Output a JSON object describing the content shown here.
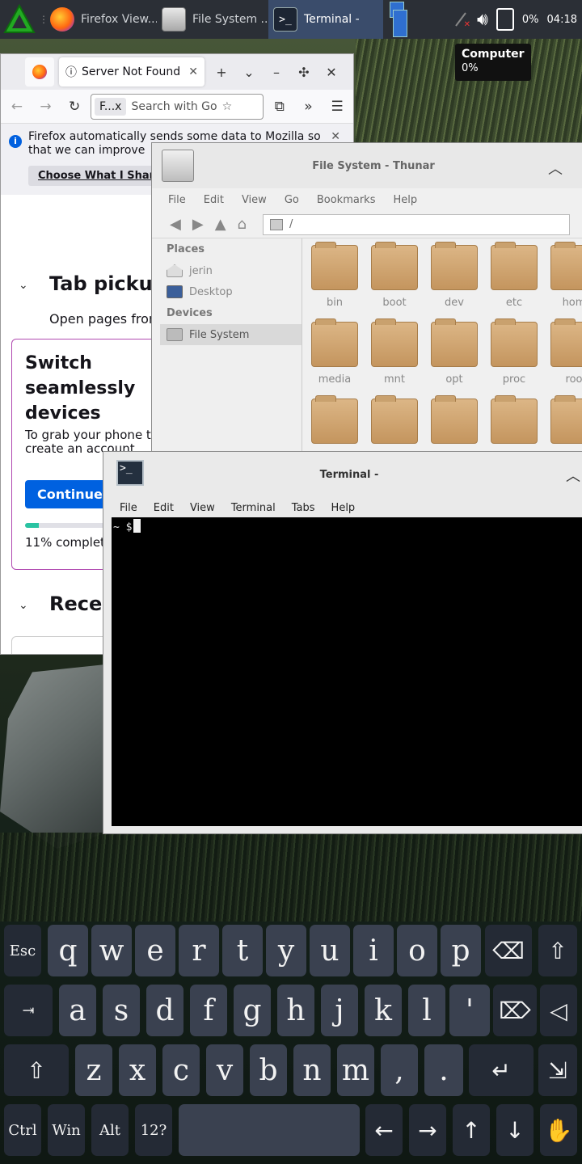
{
  "panel": {
    "tasks": [
      {
        "label": "Firefox View..."
      },
      {
        "label": "File System ..."
      },
      {
        "label": "Terminal -"
      }
    ],
    "separator": "⋮",
    "battery": "0%",
    "clock": "04:18"
  },
  "tooltip": {
    "title": "Computer",
    "value": "0%"
  },
  "firefox": {
    "tab_label": "Server Not Found",
    "url_chip": "F...x",
    "url_placeholder": "Search with Go",
    "infobar_text": "Firefox automatically sends some data to Mozilla so that we can improve",
    "infobar_button": "Choose What I Share",
    "section1_title": "Tab pickup",
    "section1_sub": "Open pages from",
    "card_title": "Switch seamlessly devices",
    "card_desc": "To grab your phone t create an account.",
    "card_button": "Continue",
    "progress_text": "11% complete",
    "progress_value": 0.11,
    "section2_title": "Recent"
  },
  "thunar": {
    "title": "File System - Thunar",
    "menu": [
      "File",
      "Edit",
      "View",
      "Go",
      "Bookmarks",
      "Help"
    ],
    "location": "/",
    "side_places": "Places",
    "side_home": "jerin",
    "side_desktop": "Desktop",
    "side_devices": "Devices",
    "side_fs": "File System",
    "folders": [
      "bin",
      "boot",
      "dev",
      "etc",
      "hom",
      "media",
      "mnt",
      "opt",
      "proc",
      "roo",
      "",
      "",
      "",
      "",
      ""
    ]
  },
  "terminal": {
    "title": "Terminal -",
    "menu": [
      "File",
      "Edit",
      "View",
      "Terminal",
      "Tabs",
      "Help"
    ],
    "prompt": "~ $"
  },
  "keyboard": {
    "rows": [
      [
        "Esc",
        "q",
        "w",
        "e",
        "r",
        "t",
        "y",
        "u",
        "i",
        "o",
        "p",
        "⌫",
        "⇧"
      ],
      [
        "⇥",
        "a",
        "s",
        "d",
        "f",
        "g",
        "h",
        "j",
        "k",
        "l",
        "'",
        "⌦",
        "◁"
      ],
      [
        "⇧",
        "z",
        "x",
        "c",
        "v",
        "b",
        "n",
        "m",
        ",",
        ".",
        "↵",
        "⇲"
      ],
      [
        "Ctrl",
        "Win",
        "Alt",
        "12?",
        "",
        "←",
        "→",
        "↑",
        "↓",
        "✋"
      ]
    ]
  }
}
